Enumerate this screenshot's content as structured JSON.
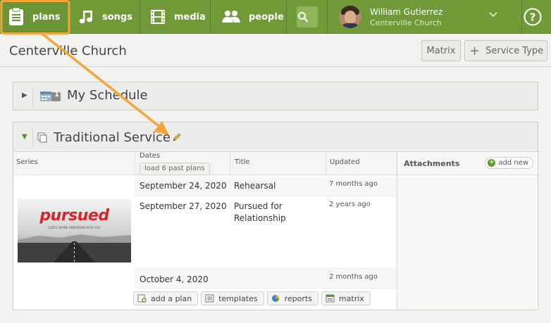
{
  "nav": {
    "plans": "plans",
    "songs": "songs",
    "media": "media",
    "people": "people",
    "user_name": "William Gutierrez",
    "user_org": "Centerville Church"
  },
  "header": {
    "title": "Centerville Church",
    "matrix_label": "Matrix",
    "service_type_label": "Service Type"
  },
  "schedule": {
    "title": "My Schedule",
    "badge": "1"
  },
  "service": {
    "title": "Traditional Service",
    "columns": {
      "series": "Series",
      "dates": "Dates",
      "title": "Title",
      "updated": "Updated"
    },
    "load_past": "load 6 past plans",
    "attachments_label": "Attachments",
    "add_new": "add new",
    "series_image_text": "pursued",
    "series_image_subtext": "GOD'S DIVINE OBSESSION WITH YOU",
    "plans": [
      {
        "date": "September 24, 2020",
        "title": "Rehearsal",
        "updated": "7 months ago"
      },
      {
        "date": "September 27, 2020",
        "title": "Pursued for Relationship",
        "updated": "2 years ago"
      },
      {
        "date": "October 4, 2020",
        "title": "",
        "updated": "2 months ago"
      }
    ],
    "actions": {
      "add_plan": "add a plan",
      "templates": "templates",
      "reports": "reports",
      "matrix": "matrix"
    }
  },
  "colors": {
    "nav_green": "#6f9a37",
    "highlight_orange": "#f5a53a",
    "pursued_red": "#d8232a"
  }
}
